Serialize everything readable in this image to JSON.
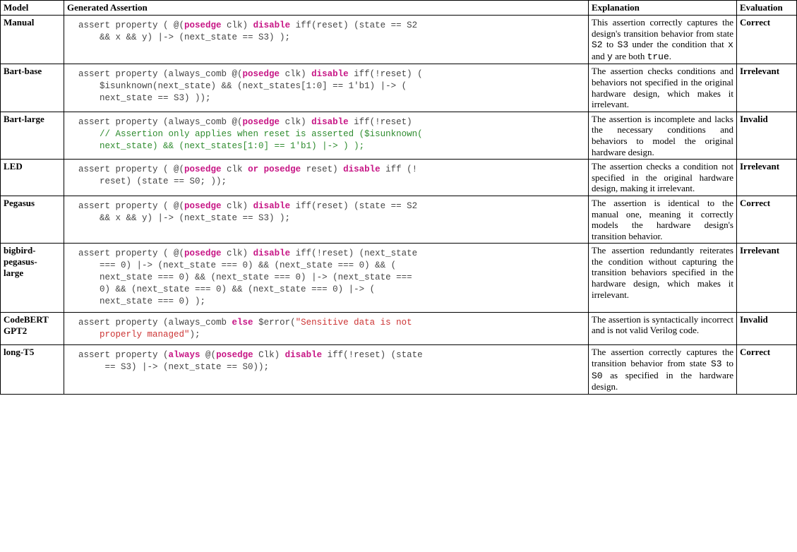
{
  "headers": {
    "model": "Model",
    "assertion": "Generated Assertion",
    "explanation": "Explanation",
    "evaluation": "Evaluation"
  },
  "rows": [
    {
      "model": "Manual",
      "code": "assert property ( @(<kw>posedge</kw> clk) <kw>disable</kw> iff(reset) (state == S2\n    && x && y) |-> (next_state == S3) );",
      "explanation": "This assertion correctly captures the design's transition behavior from state <mono>S2</mono> to <mono>S3</mono> under the condition that <mono>x</mono> and <mono>y</mono> are both <mono>true</mono>.",
      "evaluation": "Correct"
    },
    {
      "model": "Bart-base",
      "code": "assert property (always_comb @(<kw>posedge</kw> clk) <kw>disable</kw> iff(!reset) (\n    $isunknown(next_state) && (next_states[1:0] == 1'b1) |-> (\n    next_state == S3) ));",
      "explanation": "The assertion checks conditions and behaviors not specified in the original hardware design, which makes it irrelevant.",
      "evaluation": "Irrelevant"
    },
    {
      "model": "Bart-large",
      "code": "assert property (always_comb @(<kw>posedge</kw> clk) <kw>disable</kw> iff(!reset)\n    <cmt>// Assertion only applies when reset is asserted ($isunknown(\n    next_state) && (next_states[1:0] == 1'b1) |-> ) );</cmt>",
      "explanation": "The assertion is incomplete and lacks the necessary conditions and behaviors to model the original hardware design.",
      "evaluation": "Invalid"
    },
    {
      "model": "LED",
      "code": "assert property ( @(<kw>posedge</kw> clk <kw>or posedge</kw> reset) <kw>disable</kw> iff (!\n    reset) (state == S0; ));",
      "explanation": "The assertion checks a condition not specified in the original hardware design, making it irrelevant.",
      "evaluation": "Irrelevant"
    },
    {
      "model": "Pegasus",
      "code": "assert property ( @(<kw>posedge</kw> clk) <kw>disable</kw> iff(reset) (state == S2\n    && x && y) |-> (next_state == S3) );",
      "explanation": "The assertion is identical to the manual one, meaning it correctly models the hardware design's transition behavior.",
      "evaluation": "Correct"
    },
    {
      "model": "bigbird-\npegasus-\nlarge",
      "code": "assert property ( @(<kw>posedge</kw> clk) <kw>disable</kw> iff(!reset) (next_state\n    === 0) |-> (next_state === 0) && (next_state === 0) && (\n    next_state === 0) && (next_state === 0) |-> (next_state ===\n    0) && (next_state === 0) && (next_state === 0) |-> (\n    next_state === 0) );",
      "explanation": "The assertion redundantly reiterates the condition without capturing the transition behaviors specified in the hardware design, which makes it irrelevant.",
      "evaluation": "Irrelevant"
    },
    {
      "model": "CodeBERT\nGPT2",
      "code": "assert property (always_comb <kw>else</kw> $error(<str>\"Sensitive data is not\n    properly managed\"</str>);",
      "explanation": "The assertion is syntactically incorrect and is not valid Verilog code.",
      "evaluation": "Invalid"
    },
    {
      "model": "long-T5",
      "code": "assert property (<kw>always</kw> @(<kw>posedge</kw> Clk) <kw>disable</kw> iff(!reset) (state\n     == S3) |-> (next_state == S0));",
      "explanation": "The assertion correctly captures the transition behavior from state <mono>S3</mono> to <mono>S0</mono> as specified in the hardware design.",
      "evaluation": "Correct"
    }
  ]
}
